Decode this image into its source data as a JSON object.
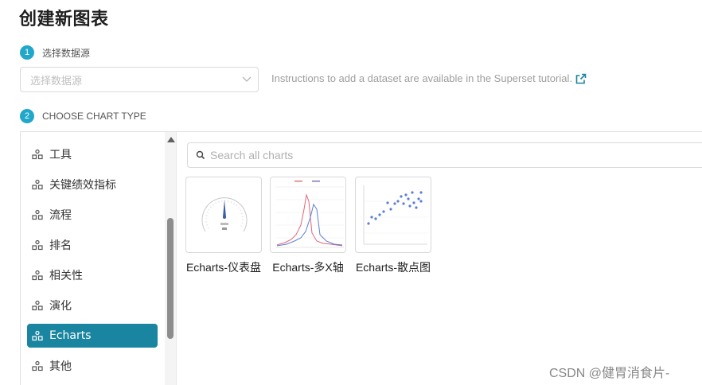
{
  "page": {
    "title": "创建新图表"
  },
  "step1": {
    "number": "1",
    "label": "选择数据源"
  },
  "datasource": {
    "placeholder": "选择数据源",
    "hint": "Instructions to add a dataset are available in the Superset tutorial.",
    "hint_icon": "external-link-icon"
  },
  "step2": {
    "number": "2",
    "label": "CHOOSE CHART TYPE"
  },
  "categories": [
    {
      "label": "工具",
      "icon": "category-icon"
    },
    {
      "label": "关键绩效指标",
      "icon": "category-icon"
    },
    {
      "label": "流程",
      "icon": "category-icon"
    },
    {
      "label": "排名",
      "icon": "category-icon"
    },
    {
      "label": "相关性",
      "icon": "category-icon"
    },
    {
      "label": "演化",
      "icon": "category-icon"
    },
    {
      "label": "Echarts",
      "icon": "category-icon",
      "selected": true
    },
    {
      "label": "其他",
      "icon": "category-icon"
    }
  ],
  "search": {
    "placeholder": "Search all charts",
    "value": ""
  },
  "charts": [
    {
      "label": "Echarts-仪表盘",
      "thumbnail": "gauge-thumbnail"
    },
    {
      "label": "Echarts-多X轴",
      "thumbnail": "multi-x-axis-line-thumbnail"
    },
    {
      "label": "Echarts-散点图",
      "thumbnail": "scatter-thumbnail"
    }
  ],
  "colors": {
    "accent": "#20a7c9",
    "selected": "#1a85a0"
  },
  "watermark": "CSDN @健胃消食片-"
}
